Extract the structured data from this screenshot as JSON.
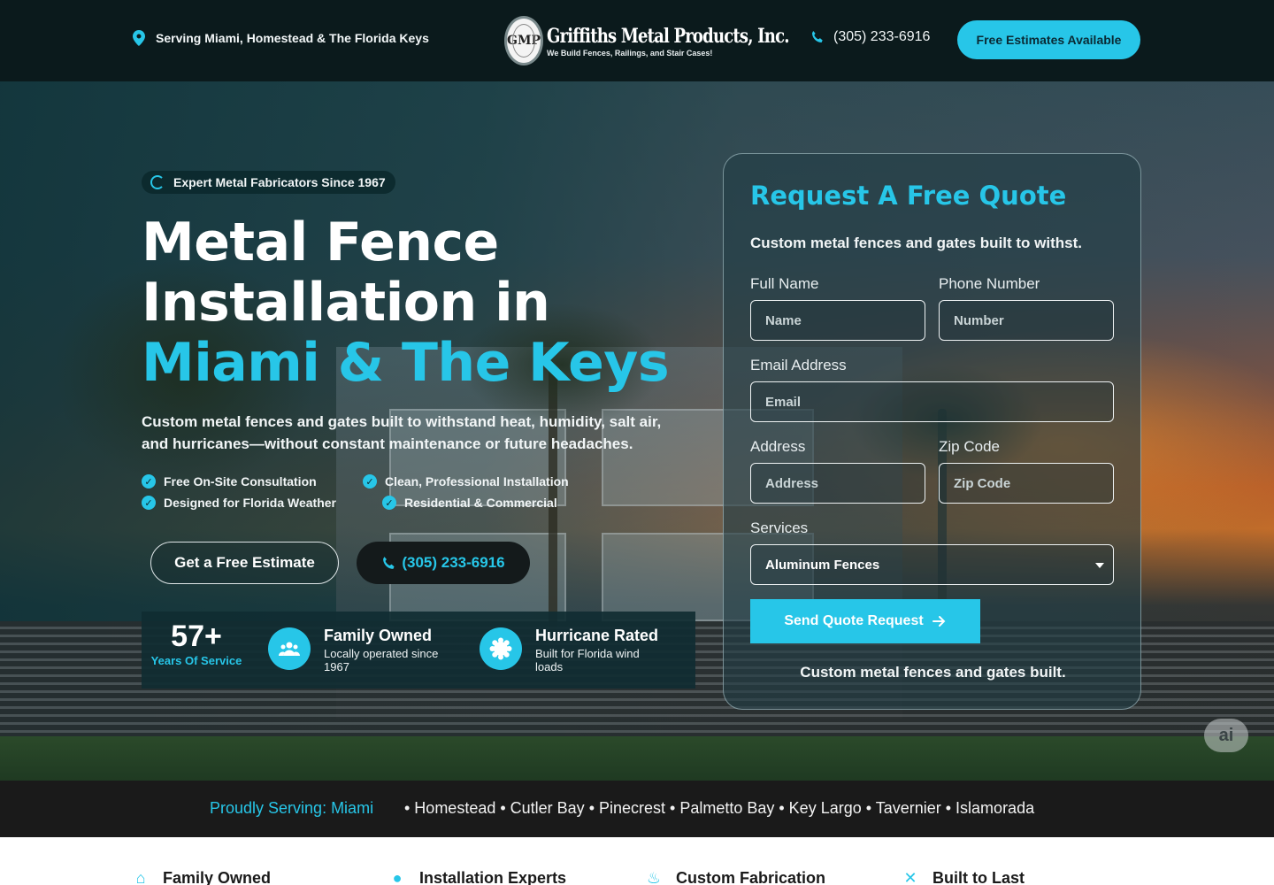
{
  "topbar": {
    "location": "Serving Miami, Homestead & The Florida Keys",
    "logo_brand": "Griffiths Metal Products, Inc.",
    "logo_tagline": "We Build Fences, Railings, and Stair Cases!",
    "logo_seal": "GMP",
    "phone": "(305) 233-6916",
    "estimate_button": "Free Estimates Available"
  },
  "hero": {
    "badge": "Expert Metal Fabricators Since 1967",
    "title_line1": "Metal Fence",
    "title_line2": "Installation in",
    "title_line3": "Miami & The Keys",
    "lead": "Custom metal fences and gates built to withstand heat, humidity, salt air, and hurricanes—without constant maintenance or future headaches.",
    "checks": [
      "Free On-Site Consultation",
      "Clean, Professional Installation",
      "Designed for Florida Weather",
      "Residential & Commercial"
    ],
    "cta_primary": "Get a Free Estimate",
    "cta_phone": "(305) 233-6916",
    "stats": {
      "years_number": "57+",
      "years_label": "Years Of Service",
      "family_title": "Family Owned",
      "family_desc": "Locally operated since 1967",
      "hurricane_title": "Hurricane Rated",
      "hurricane_desc": "Built for Florida wind loads"
    }
  },
  "form": {
    "title": "Request A Free Quote",
    "subtitle": "Custom metal fences and gates built to withst.",
    "full_name_label": "Full Name",
    "full_name_placeholder": "Name",
    "phone_label": "Phone Number",
    "phone_placeholder": "Number",
    "email_label": "Email Address",
    "email_placeholder": "Email",
    "address_label": "Address",
    "address_placeholder": "Address",
    "zip_label": "Zip Code",
    "zip_placeholder": "Zip Code",
    "services_label": "Services",
    "services_selected": "Aluminum Fences",
    "submit": "Send Quote Request",
    "footer": "Custom metal fences and gates built."
  },
  "ai_chip": "ai",
  "serving": {
    "lead": "Proudly Serving: Miami",
    "areas": "• Homestead • Cutler Bay • Pinecrest • Palmetto Bay • Key Largo • Tavernier • Islamorada"
  },
  "features": [
    "Family Owned",
    "Installation Experts",
    "Custom Fabrication",
    "Built to Last"
  ],
  "colors": {
    "accent": "#27c6e8",
    "topbar_bg": "#0b1a1c",
    "strip_bg": "#1a1a1a"
  }
}
